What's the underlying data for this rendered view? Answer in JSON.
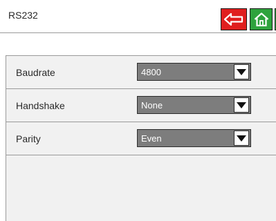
{
  "header": {
    "title": "RS232",
    "buttons": {
      "back_icon": "back-arrow-icon",
      "home_icon": "home-icon",
      "help_label": "?"
    },
    "colors": {
      "back": "#e01e1e",
      "home": "#2ea33d",
      "help": "#2ea33d"
    }
  },
  "settings": [
    {
      "label": "Baudrate",
      "value": "4800"
    },
    {
      "label": "Handshake",
      "value": "None"
    },
    {
      "label": "Parity",
      "value": "Even"
    }
  ]
}
